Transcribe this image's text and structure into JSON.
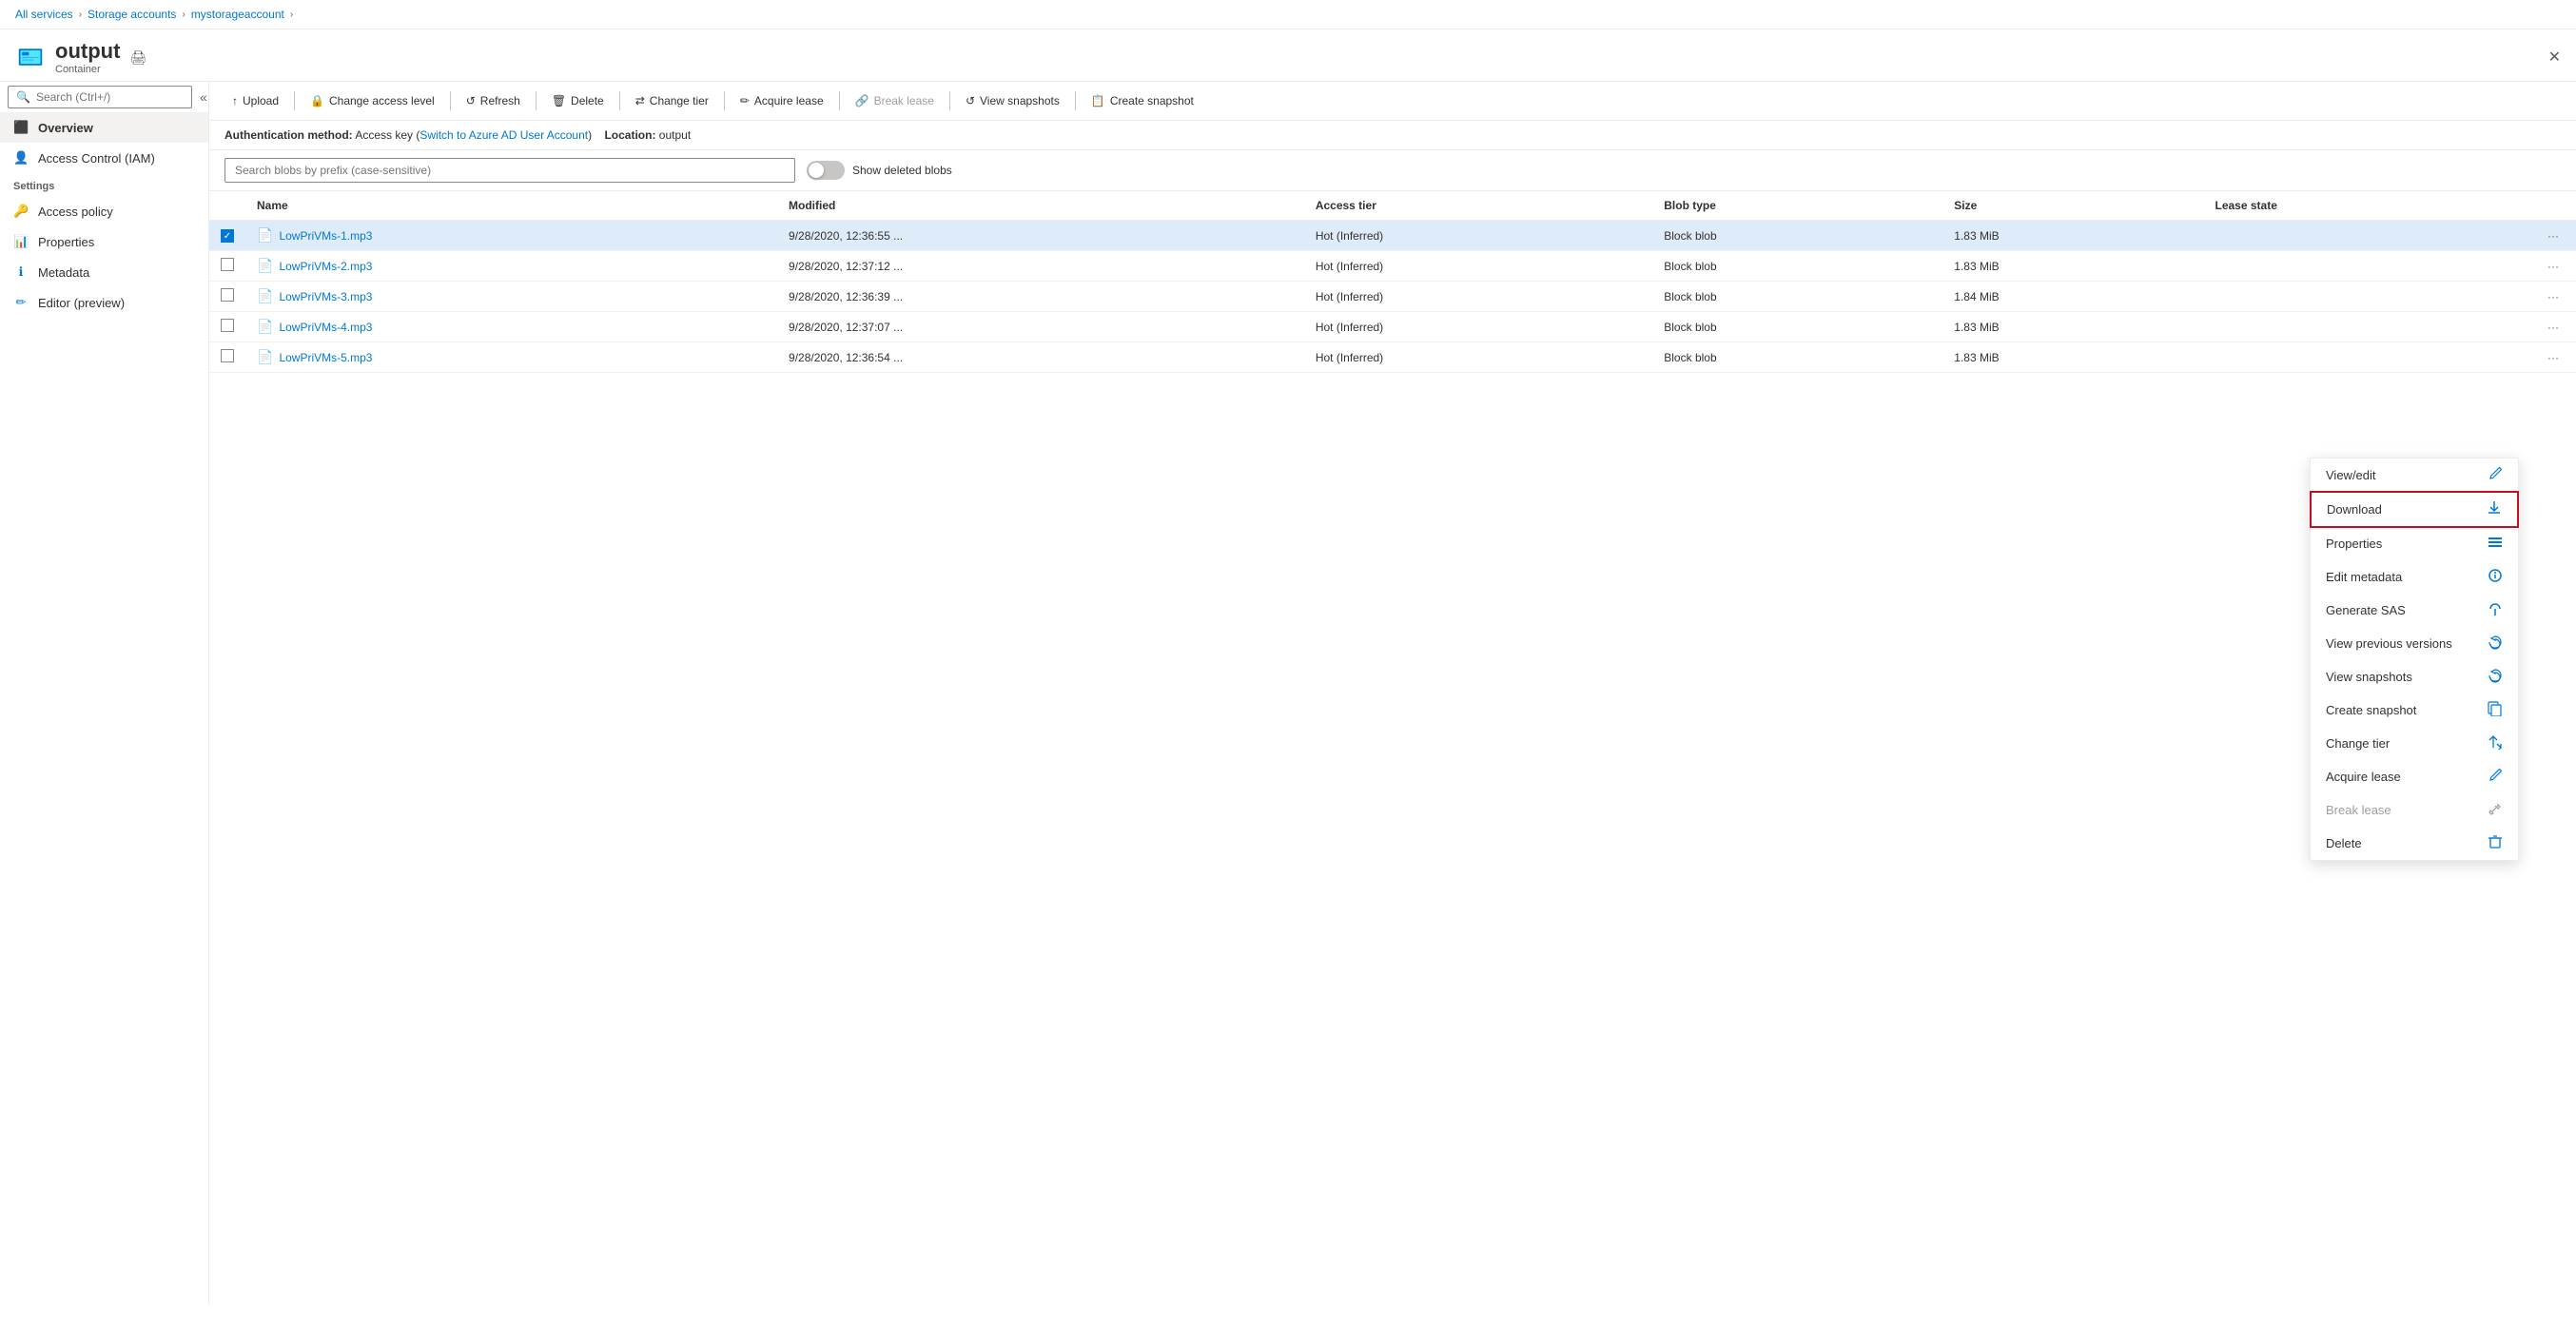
{
  "breadcrumb": {
    "items": [
      "All services",
      "Storage accounts",
      "mystorageaccount"
    ],
    "separators": [
      ">",
      ">",
      ">"
    ]
  },
  "header": {
    "title": "output",
    "subtitle": "Container",
    "close_label": "✕"
  },
  "sidebar": {
    "search_placeholder": "Search (Ctrl+/)",
    "nav_items": [
      {
        "id": "overview",
        "label": "Overview",
        "active": true
      },
      {
        "id": "access-control",
        "label": "Access Control (IAM)",
        "active": false
      }
    ],
    "settings_label": "Settings",
    "settings_items": [
      {
        "id": "access-policy",
        "label": "Access policy"
      },
      {
        "id": "properties",
        "label": "Properties"
      },
      {
        "id": "metadata",
        "label": "Metadata"
      },
      {
        "id": "editor",
        "label": "Editor (preview)"
      }
    ]
  },
  "toolbar": {
    "buttons": [
      {
        "id": "upload",
        "label": "Upload",
        "icon": "↑",
        "disabled": false
      },
      {
        "id": "change-access-level",
        "label": "Change access level",
        "icon": "🔒",
        "disabled": false
      },
      {
        "id": "refresh",
        "label": "Refresh",
        "icon": "↺",
        "disabled": false
      },
      {
        "id": "delete",
        "label": "Delete",
        "icon": "🗑",
        "disabled": false
      },
      {
        "id": "change-tier",
        "label": "Change tier",
        "icon": "⇄",
        "disabled": false
      },
      {
        "id": "acquire-lease",
        "label": "Acquire lease",
        "icon": "✏",
        "disabled": false
      },
      {
        "id": "break-lease",
        "label": "Break lease",
        "icon": "🔗",
        "disabled": true
      },
      {
        "id": "view-snapshots",
        "label": "View snapshots",
        "icon": "↺",
        "disabled": false
      },
      {
        "id": "create-snapshot",
        "label": "Create snapshot",
        "icon": "📋",
        "disabled": false
      }
    ]
  },
  "info_bar": {
    "auth_label": "Authentication method:",
    "auth_value": "Access key",
    "switch_link": "Switch to Azure AD User Account",
    "location_label": "Location:",
    "location_value": "output"
  },
  "filter_bar": {
    "placeholder": "Search blobs by prefix (case-sensitive)",
    "toggle_label": "Show deleted blobs",
    "toggle_on": false
  },
  "table": {
    "columns": [
      "Name",
      "Modified",
      "Access tier",
      "Blob type",
      "Size",
      "Lease state"
    ],
    "rows": [
      {
        "id": 1,
        "name": "LowPriVMs-1.mp3",
        "modified": "9/28/2020, 12:36:55 ...",
        "access_tier": "Hot (Inferred)",
        "blob_type": "Block blob",
        "size": "1.83 MiB",
        "lease_state": "",
        "selected": true
      },
      {
        "id": 2,
        "name": "LowPriVMs-2.mp3",
        "modified": "9/28/2020, 12:37:12 ...",
        "access_tier": "Hot (Inferred)",
        "blob_type": "Block blob",
        "size": "1.83 MiB",
        "lease_state": "",
        "selected": false
      },
      {
        "id": 3,
        "name": "LowPriVMs-3.mp3",
        "modified": "9/28/2020, 12:36:39 ...",
        "access_tier": "Hot (Inferred)",
        "blob_type": "Block blob",
        "size": "1.84 MiB",
        "lease_state": "",
        "selected": false
      },
      {
        "id": 4,
        "name": "LowPriVMs-4.mp3",
        "modified": "9/28/2020, 12:37:07 ...",
        "access_tier": "Hot (Inferred)",
        "blob_type": "Block blob",
        "size": "1.83 MiB",
        "lease_state": "",
        "selected": false
      },
      {
        "id": 5,
        "name": "LowPriVMs-5.mp3",
        "modified": "9/28/2020, 12:36:54 ...",
        "access_tier": "Hot (Inferred)",
        "blob_type": "Block blob",
        "size": "1.83 MiB",
        "lease_state": "",
        "selected": false
      }
    ]
  },
  "context_menu": {
    "items": [
      {
        "id": "view-edit",
        "label": "View/edit",
        "icon": "✏",
        "disabled": false,
        "highlighted": false
      },
      {
        "id": "download",
        "label": "Download",
        "icon": "↓",
        "disabled": false,
        "highlighted": true
      },
      {
        "id": "properties",
        "label": "Properties",
        "icon": "≡",
        "disabled": false,
        "highlighted": false
      },
      {
        "id": "edit-metadata",
        "label": "Edit metadata",
        "icon": "ℹ",
        "disabled": false,
        "highlighted": false
      },
      {
        "id": "generate-sas",
        "label": "Generate SAS",
        "icon": "🔗",
        "disabled": false,
        "highlighted": false
      },
      {
        "id": "view-previous-versions",
        "label": "View previous versions",
        "icon": "↩",
        "disabled": false,
        "highlighted": false
      },
      {
        "id": "view-snapshots",
        "label": "View snapshots",
        "icon": "↩",
        "disabled": false,
        "highlighted": false
      },
      {
        "id": "create-snapshot",
        "label": "Create snapshot",
        "icon": "📋",
        "disabled": false,
        "highlighted": false
      },
      {
        "id": "change-tier",
        "label": "Change tier",
        "icon": "⇄",
        "disabled": false,
        "highlighted": false
      },
      {
        "id": "acquire-lease",
        "label": "Acquire lease",
        "icon": "✏",
        "disabled": false,
        "highlighted": false
      },
      {
        "id": "break-lease",
        "label": "Break lease",
        "icon": "🔗",
        "disabled": true,
        "highlighted": false
      },
      {
        "id": "delete",
        "label": "Delete",
        "icon": "🗑",
        "disabled": false,
        "highlighted": false
      }
    ]
  },
  "colors": {
    "accent": "#0078d4",
    "highlight_border": "#c50f1f",
    "selected_row": "#deecf9",
    "hover": "#f3f2f1"
  }
}
